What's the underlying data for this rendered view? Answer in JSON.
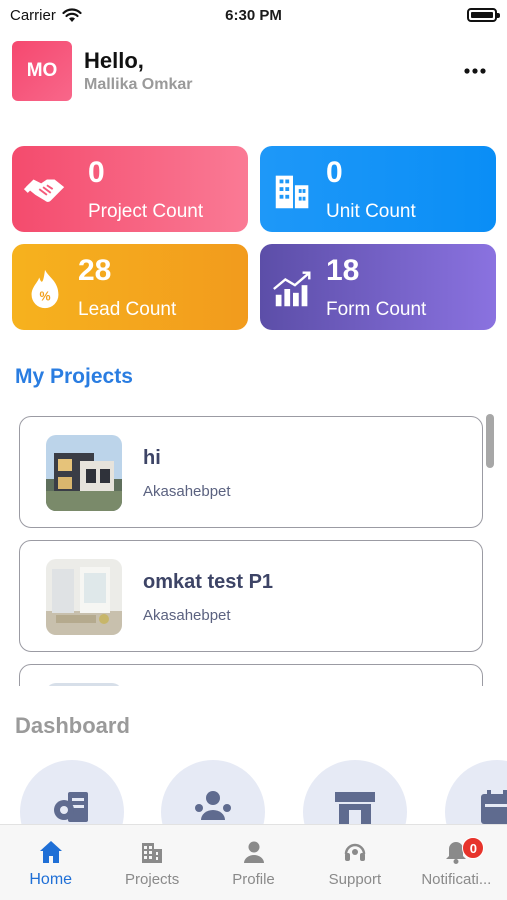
{
  "status_bar": {
    "carrier": "Carrier",
    "time": "6:30 PM"
  },
  "header": {
    "avatar_initials": "MO",
    "greeting": "Hello,",
    "user_name": "Mallika Omkar",
    "more_label": "•••"
  },
  "stats": [
    {
      "value": "0",
      "label": "Project Count",
      "icon": "handshake-icon",
      "color": "#f44b6d"
    },
    {
      "value": "0",
      "label": "Unit Count",
      "icon": "buildings-icon",
      "color": "#1e98f8"
    },
    {
      "value": "28",
      "label": "Lead Count",
      "icon": "fire-percent-icon",
      "color": "#f6b21e"
    },
    {
      "value": "18",
      "label": "Form Count",
      "icon": "growth-chart-icon",
      "color": "#6d5cc4"
    }
  ],
  "my_projects": {
    "title": "My Projects",
    "items": [
      {
        "name": "hi",
        "location": "Akasahebpet",
        "thumbnail": "house-exterior-photo"
      },
      {
        "name": "omkat test P1",
        "location": "Akasahebpet",
        "thumbnail": "interior-room-photo"
      }
    ]
  },
  "dashboard": {
    "title": "Dashboard",
    "tiles": [
      {
        "icon": "settings-document-icon"
      },
      {
        "icon": "team-icon"
      },
      {
        "icon": "storefront-icon"
      },
      {
        "icon": "calendar-icon"
      }
    ]
  },
  "bottom_nav": {
    "items": [
      {
        "label": "Home",
        "icon": "home-icon",
        "active": true
      },
      {
        "label": "Projects",
        "icon": "building-icon",
        "active": false
      },
      {
        "label": "Profile",
        "icon": "person-icon",
        "active": false
      },
      {
        "label": "Support",
        "icon": "headset-icon",
        "active": false
      },
      {
        "label": "Notificati...",
        "icon": "bell-icon",
        "active": false,
        "badge": "0"
      }
    ]
  },
  "colors": {
    "accent_blue": "#1f6fd6",
    "section_blue": "#2a7de1",
    "badge_red": "#e7332b"
  }
}
